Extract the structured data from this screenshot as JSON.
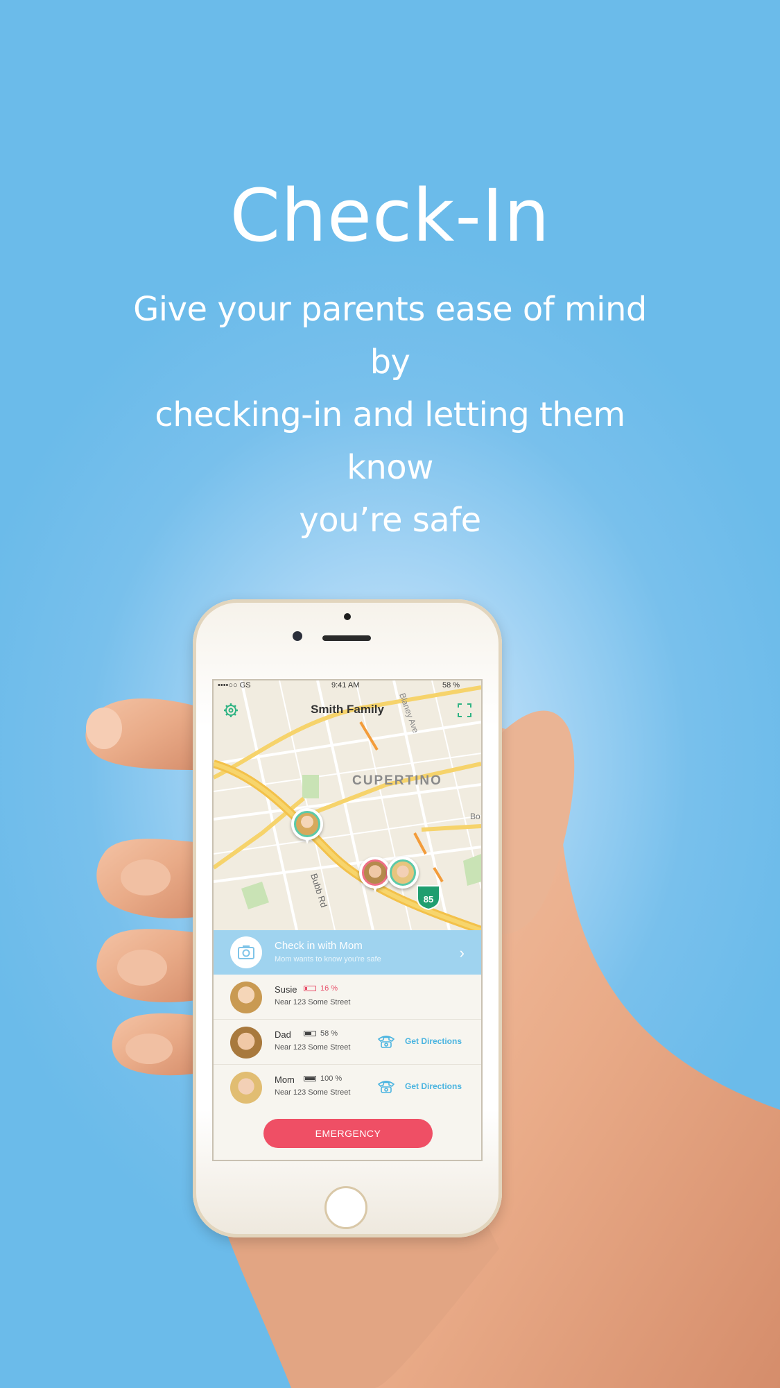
{
  "hero": {
    "title": "Check-In",
    "subtitle_line1": "Give your parents ease of mind by",
    "subtitle_line2": "checking-in and letting them know",
    "subtitle_line3": "you’re safe"
  },
  "status_bar": {
    "carrier": "••••○○ GS",
    "time": "9:41 AM",
    "battery": "58 %"
  },
  "nav": {
    "title": "Smith Family",
    "settings_icon": "gear-icon",
    "expand_icon": "expand-icon"
  },
  "map": {
    "city_label": "CUPERTINO",
    "street_1": "Bubb Rd",
    "street_2": "Blaney Ave",
    "street_3": "Bo",
    "highway_number": "85"
  },
  "checkin_banner": {
    "title": "Check in with Mom",
    "subtitle": "Mom wants to know you're safe",
    "icon": "camera-icon"
  },
  "members": [
    {
      "name": "Susie",
      "battery": "16 %",
      "battery_level": 0.16,
      "battery_color": "#e8506a",
      "address": "Near 123 Some Street",
      "show_directions": false
    },
    {
      "name": "Dad",
      "battery": "58 %",
      "battery_level": 0.58,
      "battery_color": "#444444",
      "address": "Near 123 Some Street",
      "show_directions": true,
      "directions_label": "Get Directions"
    },
    {
      "name": "Mom",
      "battery": "100 %",
      "battery_level": 1.0,
      "battery_color": "#444444",
      "address": "Near 123 Some Street",
      "show_directions": true,
      "directions_label": "Get Directions"
    }
  ],
  "emergency_button": {
    "label": "EMERGENCY"
  },
  "colors": {
    "background": "#6bbbea",
    "accent_green": "#5cc9a7",
    "accent_blue": "#4ab4e0",
    "emergency_red": "#ef4f65",
    "banner_blue": "#9fd3ef"
  }
}
